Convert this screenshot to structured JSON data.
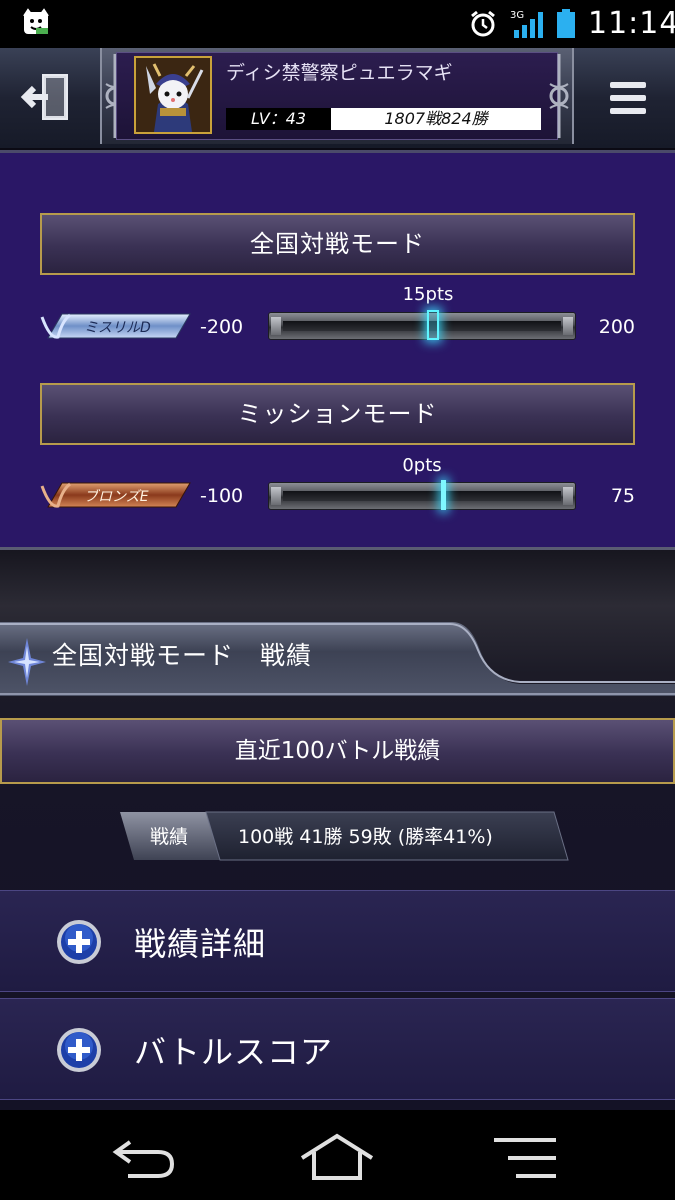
{
  "status_bar": {
    "time": "11:14",
    "network": "3G"
  },
  "header": {
    "player_name": "ディシ禁警察ピュエラマギ",
    "level": "LV：43",
    "record": "1807戦824勝"
  },
  "modes": [
    {
      "title": "全国対戦モード",
      "rank_badge": "ミスリルD",
      "min": "-200",
      "max": "200",
      "points": "15pts",
      "slider_fraction": 0.5375
    },
    {
      "title": "ミッションモード",
      "rank_badge": "ブロンズE",
      "min": "-100",
      "max": "75",
      "points": "0pts",
      "slider_fraction": 0.571
    }
  ],
  "results_section": {
    "title": "全国対戦モード　戦績",
    "recent_header": "直近100バトル戦績",
    "stats_label": "戦績",
    "stats_value": "100戦  41勝  59敗 (勝率41%)"
  },
  "accordions": [
    {
      "label": "戦績詳細"
    },
    {
      "label": "バトルスコア"
    }
  ],
  "colors": {
    "panel_purple": "#2a1766",
    "gold_border": "#b79b4c",
    "slider_glow": "#5ff5ff",
    "copper_badge": "#8a3a1c",
    "silver_badge": "#6f90c8"
  }
}
